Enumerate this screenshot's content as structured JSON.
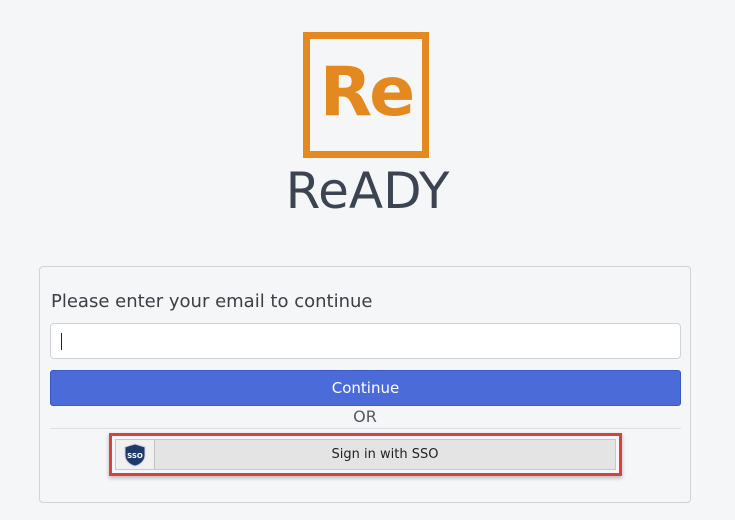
{
  "brand": {
    "logo_mark": "Re",
    "name": "ReADY",
    "accent_color": "#e3891f"
  },
  "login": {
    "prompt": "Please enter your email to continue",
    "email_value": "",
    "continue_label": "Continue",
    "or_label": "OR",
    "sso_label": "Sign in with SSO",
    "sso_icon": "sso-shield-icon",
    "sso_icon_text": "SSO",
    "primary_color": "#4a6bd8",
    "highlight_color": "#d9413f"
  }
}
